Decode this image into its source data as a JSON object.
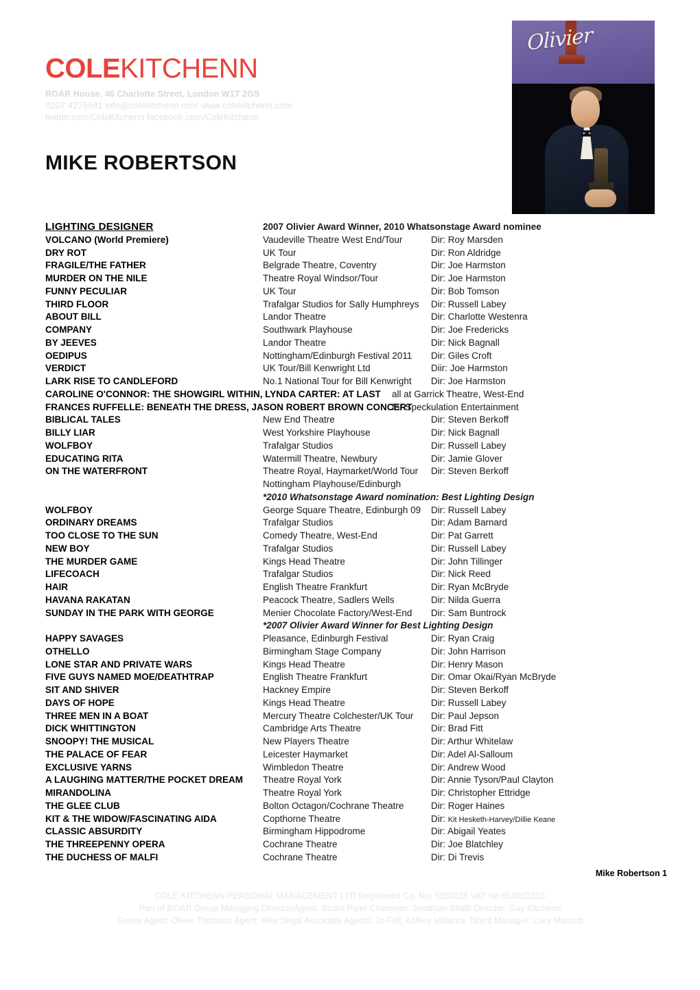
{
  "brand": {
    "logo_bold": "COLE",
    "logo_light": "KITCHENN",
    "logo_color": "#E8423C",
    "address": "ROAR House, 46 Charlotte Street, London W1T 2GS",
    "contact_line_1": "0207 4275681  info@colekitchenn.com  www.colekitchenn.com",
    "contact_line_2": "twitter.com/ColeKitchenn  facebook.com/ColeKitchenn"
  },
  "title": "MIKE ROBERTSON",
  "photo": {
    "banner_script": "Olivier",
    "alt": "Mike Robertson holding Olivier Award on stage"
  },
  "section": {
    "heading": "LIGHTING DESIGNER",
    "awards_line": "2007 Olivier Award Winner, 2010 Whatsonstage Award nominee"
  },
  "credits": [
    {
      "title": "VOLCANO (World Premiere)",
      "venue": "Vaudeville Theatre West End/Tour",
      "dir": "Dir: Roy Marsden"
    },
    {
      "title": "DRY ROT",
      "venue": "UK Tour",
      "dir": "Dir: Ron Aldridge"
    },
    {
      "title": "FRAGILE/THE FATHER",
      "venue": "Belgrade Theatre, Coventry",
      "dir": "Dir: Joe Harmston"
    },
    {
      "title": "MURDER ON THE NILE",
      "venue": "Theatre Royal Windsor/Tour",
      "dir": "Dir: Joe Harmston"
    },
    {
      "title": "FUNNY PECULIAR",
      "venue": "UK Tour",
      "dir": "Dir: Bob Tomson"
    },
    {
      "title": "THIRD FLOOR",
      "venue": "Trafalgar Studios for Sally Humphreys",
      "dir": "Dir: Russell Labey"
    },
    {
      "title": "ABOUT BILL",
      "venue": "Landor Theatre",
      "dir": "Dir: Charlotte Westenra"
    },
    {
      "title": "COMPANY",
      "venue": "Southwark Playhouse",
      "dir": "Dir: Joe Fredericks"
    },
    {
      "title": "BY JEEVES",
      "venue": "Landor Theatre",
      "dir": "Dir: Nick Bagnall"
    },
    {
      "title": "OEDIPUS",
      "venue": "Nottingham/Edinburgh Festival 2011",
      "dir": "Dir: Giles Croft"
    },
    {
      "title": "VERDICT",
      "venue": "UK Tour/Bill Kenwright Ltd",
      "dir": "Diir: Joe Harmston"
    },
    {
      "title": "LARK RISE TO CANDLEFORD",
      "venue": "No.1 National Tour for Bill Kenwright",
      "dir": "Dir: Joe Harmston"
    },
    {
      "title": "CAROLINE O'CONNOR: THE SHOWGIRL WITHIN, LYNDA CARTER: AT LAST",
      "venue": "all at Garrick Theatre, West-End",
      "dir": "",
      "wide": true
    },
    {
      "title": "FRANCES RUFFELLE: BENEATH THE DRESS, JASON ROBERT BROWN CONCERT",
      "venue": "for Speckulation Entertainment",
      "dir": "",
      "wide": true
    },
    {
      "title": "BIBLICAL TALES",
      "venue": "New End Theatre",
      "dir": "Dir: Steven Berkoff"
    },
    {
      "title": "BILLY LIAR",
      "venue": "West Yorkshire Playhouse",
      "dir": "Dir: Nick Bagnall"
    },
    {
      "title": "WOLFBOY",
      "venue": "Trafalgar Studios",
      "dir": "Dir: Russell Labey"
    },
    {
      "title": "EDUCATING RITA",
      "venue": "Watermill Theatre, Newbury",
      "dir": "Dir: Jamie Glover"
    },
    {
      "title": "ON THE WATERFRONT",
      "venue": "Theatre Royal, Haymarket/World Tour",
      "dir": "Dir: Steven Berkoff"
    },
    {
      "title": "",
      "venue": "Nottingham Playhouse/Edinburgh",
      "dir": ""
    },
    {
      "title": "",
      "venue": "*2010 Whatsonstage Award nomination: Best Lighting Design",
      "dir": "",
      "note": true
    },
    {
      "title": "WOLFBOY",
      "venue": "George Square Theatre, Edinburgh 09",
      "dir": "Dir: Russell Labey"
    },
    {
      "title": "ORDINARY DREAMS",
      "venue": "Trafalgar Studios",
      "dir": "Dir: Adam Barnard"
    },
    {
      "title": "TOO CLOSE TO THE SUN",
      "venue": "Comedy Theatre, West-End",
      "dir": "Dir: Pat Garrett"
    },
    {
      "title": "NEW BOY",
      "venue": "Trafalgar Studios",
      "dir": "Dir: Russell Labey"
    },
    {
      "title": "THE MURDER GAME",
      "venue": "Kings Head Theatre",
      "dir": "Dir: John Tillinger"
    },
    {
      "title": "LIFECOACH",
      "venue": "Trafalgar Studios",
      "dir": "Dir: Nick Reed"
    },
    {
      "title": "HAIR",
      "venue": "English Theatre Frankfurt",
      "dir": "Dir: Ryan McBryde"
    },
    {
      "title": "HAVANA RAKATAN",
      "venue": "Peacock Theatre, Sadlers Wells",
      "dir": "Dir: Nilda Guerra"
    },
    {
      "title": "SUNDAY IN THE PARK WITH GEORGE",
      "venue": "Menier Chocolate Factory/West-End",
      "dir": "Dir: Sam Buntrock"
    },
    {
      "title": "",
      "venue": "*2007 Olivier Award Winner for Best Lighting Design",
      "dir": "",
      "note": true
    },
    {
      "title": "HAPPY SAVAGES",
      "venue": "Pleasance, Edinburgh Festival",
      "dir": "Dir: Ryan Craig"
    },
    {
      "title": "OTHELLO",
      "venue": "Birmingham Stage Company",
      "dir": "Dir: John Harrison"
    },
    {
      "title": "LONE STAR AND PRIVATE WARS",
      "venue": "Kings Head Theatre",
      "dir": "Dir: Henry Mason"
    },
    {
      "title": "FIVE GUYS NAMED MOE/DEATHTRAP",
      "venue": "English Theatre Frankfurt",
      "dir": "Dir: Omar Okai/Ryan McBryde"
    },
    {
      "title": "SIT AND SHIVER",
      "venue": "Hackney Empire",
      "dir": "Dir: Steven Berkoff"
    },
    {
      "title": "DAYS OF HOPE",
      "venue": "Kings Head Theatre",
      "dir": "Dir: Russell Labey"
    },
    {
      "title": "THREE MEN IN A BOAT",
      "venue": "Mercury Theatre Colchester/UK Tour",
      "dir": "Dir: Paul Jepson"
    },
    {
      "title": "DICK WHITTINGTON",
      "venue": "Cambridge Arts Theatre",
      "dir": "Dir: Brad Fitt"
    },
    {
      "title": "SNOOPY! THE MUSICAL",
      "venue": "New Players Theatre",
      "dir": "Dir: Arthur Whitelaw"
    },
    {
      "title": "THE PALACE OF FEAR",
      "venue": "Leicester Haymarket",
      "dir": "Dir: Adel Al-Salloum"
    },
    {
      "title": "EXCLUSIVE YARNS",
      "venue": "Wimbledon Theatre",
      "dir": "Dir: Andrew Wood"
    },
    {
      "title": "A LAUGHING MATTER/THE POCKET DREAM",
      "venue": "Theatre Royal York",
      "dir": "Dir: Annie Tyson/Paul Clayton"
    },
    {
      "title": "MIRANDOLINA",
      "venue": "Theatre Royal York",
      "dir": "Dir: Christopher Ettridge"
    },
    {
      "title": "THE GLEE CLUB",
      "venue": "Bolton Octagon/Cochrane Theatre",
      "dir": "Dir: Roger Haines"
    },
    {
      "title": "KIT & THE WIDOW/FASCINATING AIDA",
      "venue": "Copthorne Theatre",
      "dir": "Dir: ",
      "dir_small": "Kit Hesketh-Harvey/Dillie Keane"
    },
    {
      "title": "CLASSIC ABSURDITY",
      "venue": "Birmingham Hippodrome",
      "dir": "Dir: Abigail Yeates"
    },
    {
      "title": "THE THREEPENNY OPERA",
      "venue": "Cochrane Theatre",
      "dir": "Dir: Joe Blatchley"
    },
    {
      "title": "THE DUCHESS OF MALFI",
      "venue": "Cochrane Theatre",
      "dir": "Dir: Di Trevis"
    }
  ],
  "page_number": "Mike Robertson 1",
  "footer": {
    "line_1": "COLE KITCHENN PERSONAL MANAGEMENT LTD Registered Co. No: 5350236  VAT No 853912316",
    "line_2": "Part of ROAR Group  Managing Director/Agent: Stuart Piper  Chairman: Jonathan Shalit  Director: Guy Kitchenn",
    "line_3": "Senior Agent: Oliver Thomson  Agent: Alex Segal  Associate Agents: Jo Fell, Ashley Vallance Talent Manager: Lucy Marriott"
  }
}
